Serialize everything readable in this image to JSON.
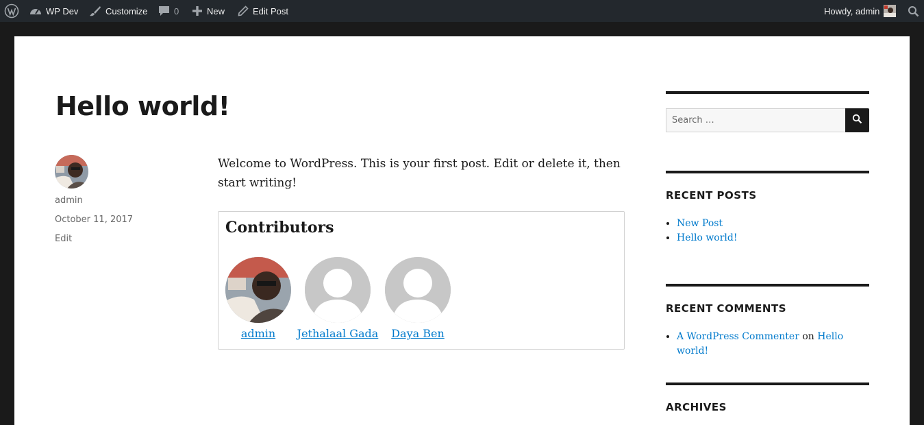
{
  "admin_bar": {
    "site_name": "WP Dev",
    "customize": "Customize",
    "comments_count": "0",
    "new": "New",
    "edit_post": "Edit Post",
    "howdy": "Howdy, admin"
  },
  "post": {
    "title": "Hello world!",
    "author": "admin",
    "date": "October 11, 2017",
    "edit": "Edit",
    "content": "Welcome to WordPress. This is your first post. Edit or delete it, then start writing!"
  },
  "contributors": {
    "title": "Contributors",
    "items": [
      {
        "name": "admin"
      },
      {
        "name": "Jethalaal Gada"
      },
      {
        "name": "Daya Ben"
      }
    ]
  },
  "sidebar": {
    "search_placeholder": "Search …",
    "recent_posts_title": "RECENT POSTS",
    "recent_posts": [
      "New Post",
      "Hello world!"
    ],
    "recent_comments_title": "RECENT COMMENTS",
    "recent_comment": {
      "author": "A WordPress Commenter",
      "joiner": "on",
      "post": "Hello world!"
    },
    "archives_title": "ARCHIVES"
  },
  "colors": {
    "link": "#007acc",
    "admin_bar": "#23282d",
    "text": "#1a1a1a"
  },
  "icons": [
    "wordpress-icon",
    "dashboard-icon",
    "brush-icon",
    "comment-icon",
    "plus-icon",
    "pencil-icon",
    "search-icon"
  ]
}
